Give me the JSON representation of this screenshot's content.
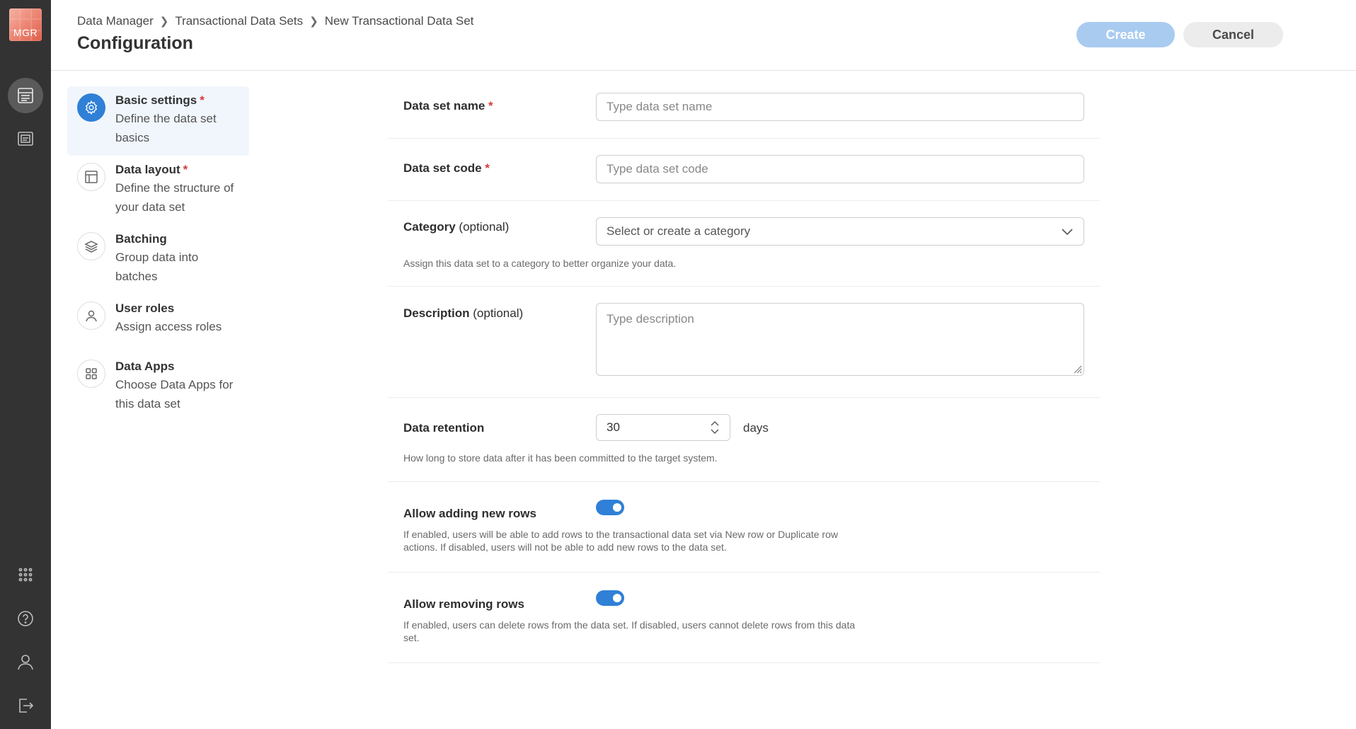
{
  "rail": {
    "logo_text": "MGR",
    "items": [
      {
        "name": "data-sets-icon",
        "active": true
      },
      {
        "name": "reports-icon",
        "active": false
      }
    ],
    "bottom_items": [
      "apps-grid-icon",
      "help-icon",
      "user-icon",
      "logout-icon"
    ]
  },
  "header": {
    "breadcrumb": [
      "Data Manager",
      "Transactional Data Sets",
      "New Transactional Data Set"
    ],
    "title": "Configuration",
    "create_label": "Create",
    "cancel_label": "Cancel"
  },
  "steps": [
    {
      "title": "Basic settings",
      "required": "*",
      "desc": "Define the data set basics",
      "icon": "gear-icon"
    },
    {
      "title": "Data layout",
      "required": "*",
      "desc": "Define the structure of your data set",
      "icon": "layout-icon"
    },
    {
      "title": "Batching",
      "required": "",
      "desc": "Group data into batches",
      "icon": "layers-icon"
    },
    {
      "title": "User roles",
      "required": "",
      "desc": "Assign access roles",
      "icon": "user-icon"
    },
    {
      "title": "Data Apps",
      "required": "",
      "desc": "Choose Data Apps for this data set",
      "icon": "apps-icon"
    }
  ],
  "form": {
    "name": {
      "label": "Data set name",
      "required": "*",
      "placeholder": "Type data set name"
    },
    "code": {
      "label": "Data set code",
      "required": "*",
      "placeholder": "Type data set code"
    },
    "category": {
      "label": "Category",
      "optional": "(optional)",
      "placeholder": "Select or create a category",
      "hint": "Assign this data set to a category to better organize your data."
    },
    "description": {
      "label": "Description",
      "optional": "(optional)",
      "placeholder": "Type description"
    },
    "retention": {
      "label": "Data retention",
      "value": "30",
      "unit": "days",
      "hint": "How long to store data after it has been committed to the target system."
    },
    "allow_add": {
      "label": "Allow adding new rows",
      "enabled": true,
      "hint": "If enabled, users will be able to add rows to the transactional data set via New row or Duplicate row actions. If disabled, users will not be able to add new rows to the data set."
    },
    "allow_remove": {
      "label": "Allow removing rows",
      "enabled": true,
      "hint": "If enabled, users can delete rows from the data set. If disabled, users cannot delete rows from this data set."
    }
  },
  "colors": {
    "accent": "#2f80d6",
    "rail": "#333333",
    "required": "#d53a3a",
    "create_disabled": "#a9cbf0"
  }
}
